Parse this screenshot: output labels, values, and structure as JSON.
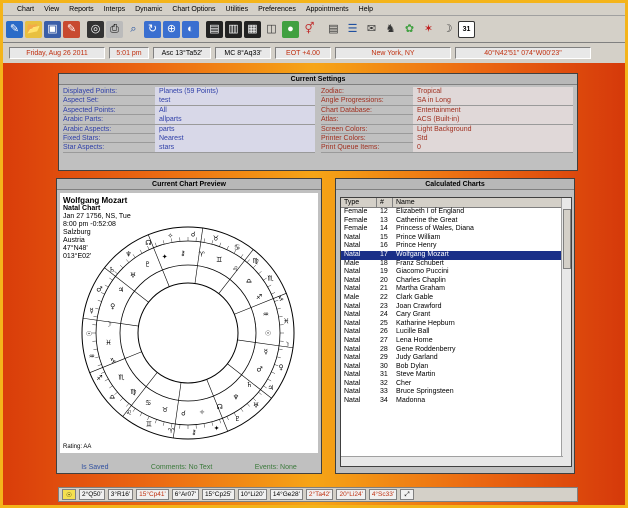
{
  "menu": [
    "Chart",
    "View",
    "Reports",
    "Interps",
    "Dynamic",
    "Chart Options",
    "Utilities",
    "Preferences",
    "Appointments",
    "Help"
  ],
  "toolbar": {
    "icons": [
      "new-chart-icon",
      "open-folder-icon",
      "save-icon",
      "edit-icon",
      "chart-wheel-icon",
      "print-icon",
      "search-icon",
      "refresh-icon",
      "zoom-icon",
      "globe-icon",
      "progression-icon",
      "transit-icon",
      "grid-icon",
      "report-icon",
      "mail-icon",
      "compare-icon",
      "astrologer-icon",
      "settings-gear-icon",
      "star-icon",
      "moon-icon",
      "calendar-icon"
    ],
    "calendar_label": "31"
  },
  "status": {
    "date": "Friday, Aug 26 2011",
    "time": "5:01 pm",
    "asc": "Asc 13°Ta52'",
    "mc": "MC 8°Aq33'",
    "eot": "EOT +4.00",
    "location": "New York, NY",
    "coords": "40°N42'51\" 074°W00'23\""
  },
  "settings": {
    "title": "Current Settings",
    "left": [
      {
        "k": "Displayed Points:",
        "v": "Planets (59 Points)"
      },
      {
        "k": "Aspect Set:",
        "v": "test"
      },
      {
        "k": "Aspected Points:",
        "v": "All"
      },
      {
        "k": "Arabic Parts:",
        "v": "allparts"
      },
      {
        "k": "Arabic Aspects:",
        "v": "parts"
      },
      {
        "k": "Fixed Stars:",
        "v": "Nearest"
      },
      {
        "k": "Star Aspects:",
        "v": "stars"
      }
    ],
    "right": [
      {
        "k": "Zodiac:",
        "v": "Tropical"
      },
      {
        "k": "Angle Progressions:",
        "v": "SA in Long"
      },
      {
        "k": "Chart Database:",
        "v": "Entertainment"
      },
      {
        "k": "Atlas:",
        "v": "ACS (Built-in)"
      },
      {
        "k": "Screen Colors:",
        "v": "Light Background"
      },
      {
        "k": "Printer Colors:",
        "v": "Std"
      },
      {
        "k": "Print Queue Items:",
        "v": "0"
      }
    ]
  },
  "preview": {
    "title": "Current Chart Preview",
    "name": "Wolfgang Mozart",
    "chart_kind": "Natal Chart",
    "lines": [
      "Jan 27 1756, NS, Tue",
      "8:00 pm  -0:52:08",
      "Salzburg",
      "Austria",
      "47°N48'",
      "013°E02'"
    ],
    "rating": "Rating: AA",
    "links": [
      "Is Saved",
      "Comments: No Text",
      "Events: None"
    ]
  },
  "calc": {
    "title": "Calculated Charts",
    "columns": [
      "Type",
      "#",
      "Name"
    ],
    "rows": [
      [
        "Female",
        "12",
        "Elizabeth I of England"
      ],
      [
        "Female",
        "13",
        "Catherine the Great"
      ],
      [
        "Female",
        "14",
        "Princess of Wales, Diana"
      ],
      [
        "Natal",
        "15",
        "Prince William"
      ],
      [
        "Natal",
        "16",
        "Prince Henry"
      ],
      [
        "Natal",
        "17",
        "Wolfgang Mozart"
      ],
      [
        "Male",
        "18",
        "Franz Schubert"
      ],
      [
        "Natal",
        "19",
        "Giacomo Puccini"
      ],
      [
        "Natal",
        "20",
        "Charles Chaplin"
      ],
      [
        "Natal",
        "21",
        "Martha Graham"
      ],
      [
        "Male",
        "22",
        "Clark Gable"
      ],
      [
        "Natal",
        "23",
        "Joan Crawford"
      ],
      [
        "Natal",
        "24",
        "Cary Grant"
      ],
      [
        "Natal",
        "25",
        "Katharine Hepburn"
      ],
      [
        "Natal",
        "26",
        "Lucille Ball"
      ],
      [
        "Natal",
        "27",
        "Lena Horne"
      ],
      [
        "Natal",
        "28",
        "Gene Roddenberry"
      ],
      [
        "Natal",
        "29",
        "Judy Garland"
      ],
      [
        "Natal",
        "30",
        "Bob Dylan"
      ],
      [
        "Natal",
        "31",
        "Steve Martin"
      ],
      [
        "Natal",
        "32",
        "Cher"
      ],
      [
        "Natal",
        "33",
        "Bruce Springsteen"
      ],
      [
        "Natal",
        "34",
        "Madonna"
      ]
    ],
    "selected_index": 5
  },
  "bottom": [
    "2°Q50'",
    "3°R16'",
    "15°Cp41'",
    "6°Ar07'",
    "15°Cp25'",
    "10°Li20'",
    "14°Ge28'",
    "2°Ta42'",
    "20°Li24'",
    "4°Sc33'"
  ],
  "colors": {
    "selection": "#1a2f88",
    "accent_red": "#c03010",
    "setting_blue": "#3040a8"
  }
}
